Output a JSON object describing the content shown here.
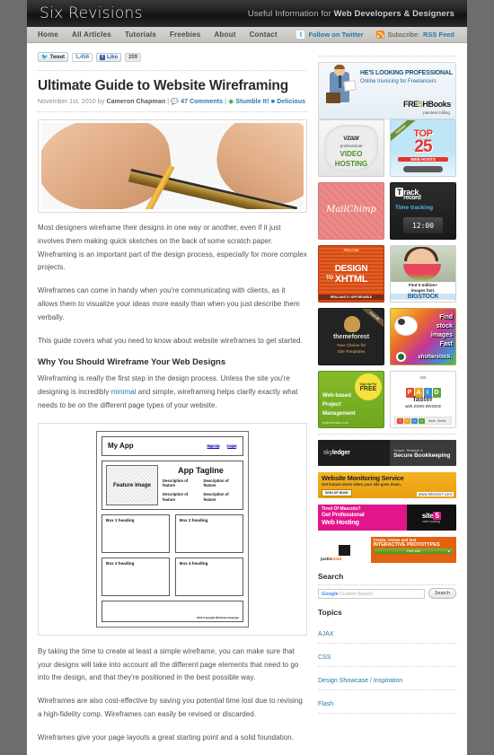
{
  "site": {
    "logo": "Six Revisions",
    "tagline_lead": "Useful Information for ",
    "tagline_bold": "Web Developers & Designers"
  },
  "nav": {
    "items": [
      {
        "label": "Home"
      },
      {
        "label": "All Articles"
      },
      {
        "label": "Tutorials"
      },
      {
        "label": "Freebies"
      },
      {
        "label": "About"
      },
      {
        "label": "Contact"
      }
    ],
    "twitter_label": "Follow on Twitter",
    "twitter_icon": "twitter-icon",
    "rss_icon": "rss-icon",
    "rss_prefix": "Subscribe:",
    "rss_label": "RSS Feed"
  },
  "share": {
    "tweet_label": "Tweet",
    "tweet_count": "1,456",
    "like_label": "Like",
    "like_count": "209"
  },
  "post": {
    "title": "Ultimate Guide to Website Wireframing",
    "date": "November 1st, 2010",
    "by": "by",
    "author": "Cameron Chapman",
    "comments": "47 Comments",
    "stumble": "Stumble It!",
    "delicious": "Delicious",
    "photo_alt": "hands drawing a wireframe with pencil and ruler",
    "paragraphs": [
      "Most designers wireframe their designs in one way or another, even if it just involves them making quick sketches on the back of some scratch paper. Wireframing is an important part of the design process, especially for more complex projects.",
      "Wireframes can come in handy when you're communicating with clients, as it allows them to visualize your ideas more easily than when you just describe them verbally.",
      "This guide covers what you need to know about website wireframes to get started."
    ],
    "section_heading": "Why You Should Wireframe Your Web Designs",
    "section_p1_a": "Wireframing is really the first step in the design process. Unless the site you're designing is incredibly ",
    "section_p1_link": "minimal",
    "section_p1_b": " and simple, wireframing helps clarify exactly what needs to be on the different page types of your website.",
    "after_paragraphs": [
      "By taking the time to create at least a simple wireframe, you can make sure that your designs will take into account all the different page elements that need to go into the design, and that they're positioned in the best possible way.",
      "Wireframes are also cost-effective by saving you potential time lost due to revising a high-fidelity comp. Wireframes can easily be revised or discarded.",
      "Wireframes give your page layouts a great starting point and a solid foundation."
    ]
  },
  "wireframe": {
    "app_name": "My App",
    "signup": "Sign Up",
    "login": "Login",
    "feature_image": "Feature Image",
    "tagline": "App Tagline",
    "features": [
      "Description of feature",
      "Description of feature",
      "Description of feature",
      "Description of feature"
    ],
    "boxes": [
      "Box 1 heading",
      "Box 2 heading",
      "Box 3 heading",
      "Box 4 heading"
    ],
    "copyright": "2010 Copyright Wireframe Example"
  },
  "ads": {
    "freshbooks": {
      "line1": "HE'S LOOKING PROFESSIONAL",
      "line2": "Online Invoicing for Freelancers",
      "brand_a": "FRE",
      "brand_leaf": "5",
      "brand_b": "HBooks",
      "brand_sub": "painless billing"
    },
    "vzaar": {
      "brand": "vzaar",
      "professional": "professional",
      "video": "VIDEO",
      "hosting": "HOSTING"
    },
    "top25": {
      "ribbon": "Updated",
      "top": "TOP",
      "number": "25",
      "webhosts": "WEB HOSTS"
    },
    "mailchimp": {
      "brand": "MailChimp"
    },
    "trackrecord": {
      "t_letter": "T",
      "rack": "rack",
      "record": "record",
      "sub": "Time tracking",
      "clock": "12:00"
    },
    "designxhtml": {
      "top": "PSD.COM",
      "design": "DESIGN",
      "to": "TO",
      "xhtml": "XHTML",
      "bottom": "BRILLIANTLY AFFORDABLE"
    },
    "bigstock": {
      "line1": "Find 5 million+",
      "line2": "images fast.",
      "brand": "BIGSTOCK"
    },
    "themeforest": {
      "ribbon": "From $5",
      "brand": "themeforest",
      "sub1": "Your Choice for",
      "sub2": "Site Templates"
    },
    "shutterstock": {
      "w1": "Find",
      "w2": "stock",
      "w3": "images",
      "w4": "Fast",
      "brand": "shutterstock."
    },
    "intervals": {
      "badge_top": "Sign Up For",
      "badge_big": "FREE",
      "l1": "Web-based",
      "l2": "Project",
      "l3": "Management",
      "url": "myintervals.com"
    },
    "zoho": {
      "get": "Get",
      "paid": [
        "P",
        "A",
        "I",
        "D"
      ],
      "faster": "faster",
      "with": "with ZOHO INVOICE",
      "bar_brand": "Zoho",
      "bar_sub": "Work. Online"
    },
    "skyledger": {
      "brand_light": "sky",
      "brand_bold": "ledger",
      "sub1": "Simple, Reliable &",
      "sub2": "Secure Bookkeeping"
    },
    "sitemonitoring": {
      "title": "Website Monitoring Service",
      "sub": "Get instant alerts when your site goes down.",
      "button": "SIGN UP NOW!",
      "button_sub": "Starts at $5",
      "url": "www.Site24x7.com"
    },
    "site5": {
      "l1": "Tired Of Mascots?",
      "l2": "Get Professional",
      "l3": "Web Hosting",
      "brand": "site",
      "brand_num": "5",
      "brand_sub": "web hosting"
    },
    "justinmind": {
      "brand_a": "justin",
      "brand_b": "mind",
      "l1": "Create, review and test",
      "l2": "INTERACTIVE PROTOTYPES",
      "cta": "Free trial"
    }
  },
  "search": {
    "heading": "Search",
    "google_mark": "Google",
    "placeholder": "Custom Search",
    "button": "Search"
  },
  "topics": {
    "heading": "Topics",
    "items": [
      {
        "label": "AJAX"
      },
      {
        "label": "CSS"
      },
      {
        "label": "Design Showcase / Inspiration"
      },
      {
        "label": "Flash"
      }
    ]
  }
}
